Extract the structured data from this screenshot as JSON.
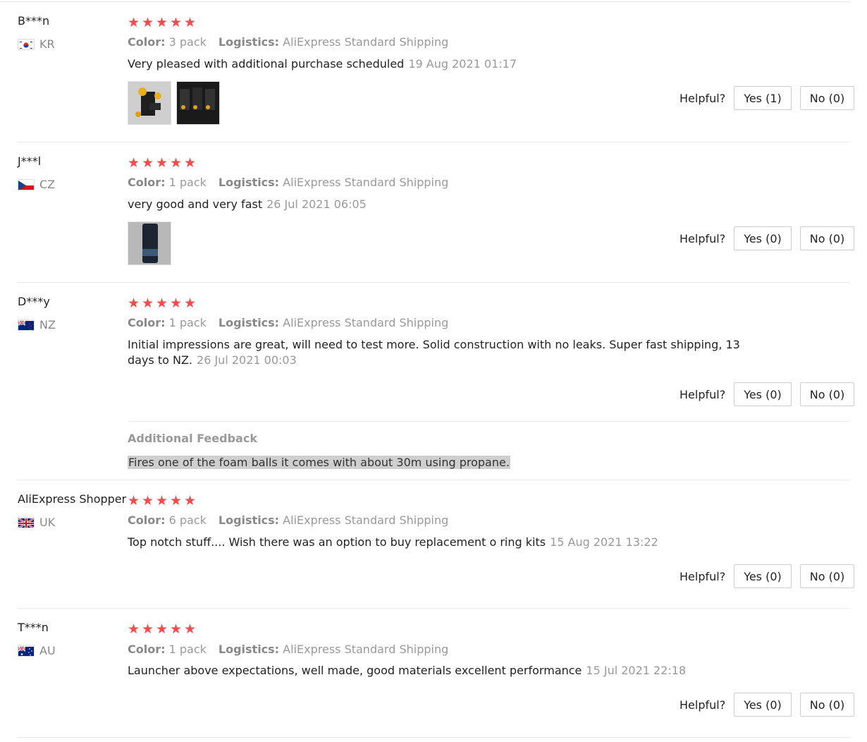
{
  "helpful_label": "Helpful?",
  "reviews": [
    {
      "user": "B***n",
      "country": "KR",
      "flag": "kr",
      "color_label": "Color:",
      "color": "3 pack",
      "logistics_label": "Logistics:",
      "logistics": "AliExpress Standard Shipping",
      "text": "Very pleased with additional purchase scheduled",
      "date": "19 Aug 2021 01:17",
      "yes": "Yes (1)",
      "no": "No (0)"
    },
    {
      "user": "J***l",
      "country": "CZ",
      "flag": "cz",
      "color_label": "Color:",
      "color": "1 pack",
      "logistics_label": "Logistics:",
      "logistics": "AliExpress Standard Shipping",
      "text": "very good and very fast",
      "date": "26 Jul 2021 06:05",
      "yes": "Yes (0)",
      "no": "No (0)"
    },
    {
      "user": "D***y",
      "country": "NZ",
      "flag": "nz",
      "color_label": "Color:",
      "color": "1 pack",
      "logistics_label": "Logistics:",
      "logistics": "AliExpress Standard Shipping",
      "text": "Initial impressions are great, will need to test more. Solid construction with no leaks. Super fast shipping, 13 days to NZ.",
      "date": "26 Jul 2021 00:03",
      "yes": "Yes (0)",
      "no": "No (0)",
      "additional_title": "Additional Feedback",
      "additional_text": "Fires one of the foam balls it comes with about 30m using propane."
    },
    {
      "user": "AliExpress Shopper",
      "country": "UK",
      "flag": "uk",
      "color_label": "Color:",
      "color": "6 pack",
      "logistics_label": "Logistics:",
      "logistics": "AliExpress Standard Shipping",
      "text": "Top notch stuff.... Wish there was an option to buy replacement o ring kits",
      "date": "15 Aug 2021 13:22",
      "yes": "Yes (0)",
      "no": "No (0)"
    },
    {
      "user": "T***n",
      "country": "AU",
      "flag": "au",
      "color_label": "Color:",
      "color": "1 pack",
      "logistics_label": "Logistics:",
      "logistics": "AliExpress Standard Shipping",
      "text": "Launcher above expectations, well made, good materials excellent performance",
      "date": "15 Jul 2021 22:18",
      "yes": "Yes (0)",
      "no": "No (0)"
    }
  ]
}
